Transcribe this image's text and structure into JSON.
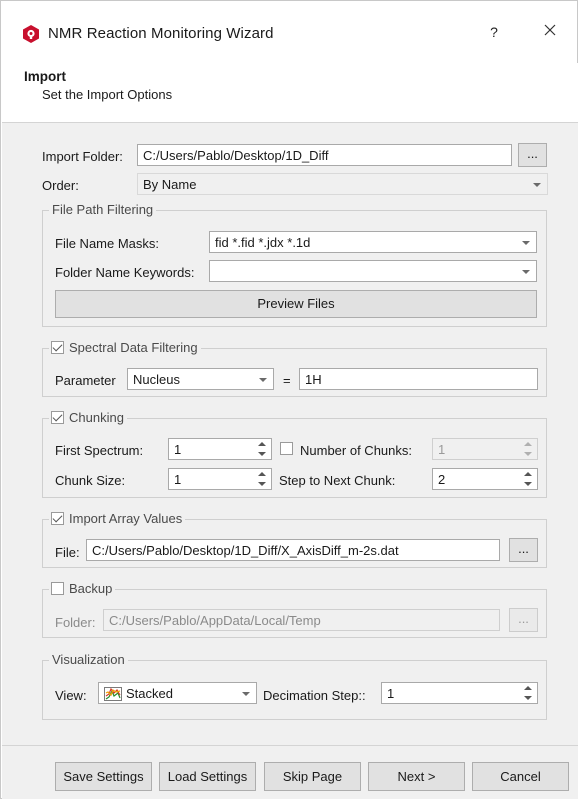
{
  "window": {
    "title": "NMR Reaction Monitoring Wizard",
    "help_label": "?",
    "close_label": "✕",
    "icon": "app-logo-icon"
  },
  "header": {
    "title": "Import",
    "subtitle": "Set the Import Options"
  },
  "import": {
    "folder_label": "Import Folder:",
    "folder_value": "C:/Users/Pablo/Desktop/1D_Diff",
    "browse_label": "...",
    "order_label": "Order:",
    "order_value": "By Name"
  },
  "file_path_filtering": {
    "legend": "File Path Filtering",
    "masks_label": "File Name Masks:",
    "masks_value": "fid *.fid *.jdx *.1d",
    "keywords_label": "Folder Name Keywords:",
    "keywords_value": "",
    "preview_label": "Preview Files"
  },
  "spectral_filtering": {
    "legend": "Spectral Data Filtering",
    "checked": true,
    "parameter_label": "Parameter",
    "parameter_value": "Nucleus",
    "equals": "=",
    "value": "1H"
  },
  "chunking": {
    "legend": "Chunking",
    "checked": true,
    "first_spectrum_label": "First Spectrum:",
    "first_spectrum_value": "1",
    "num_chunks_label": "Number of Chunks:",
    "num_chunks_checked": false,
    "num_chunks_value": "1",
    "chunk_size_label": "Chunk Size:",
    "chunk_size_value": "1",
    "step_label": "Step to Next Chunk:",
    "step_value": "2"
  },
  "array_values": {
    "legend": "Import Array Values",
    "checked": true,
    "file_label": "File:",
    "file_value": "C:/Users/Pablo/Desktop/1D_Diff/X_AxisDiff_m-2s.dat",
    "browse_label": "..."
  },
  "backup": {
    "legend": "Backup",
    "checked": false,
    "folder_label": "Folder:",
    "folder_value": "C:/Users/Pablo/AppData/Local/Temp",
    "browse_label": "..."
  },
  "visualization": {
    "legend": "Visualization",
    "view_label": "View:",
    "view_value": "Stacked",
    "view_icon": "stacked-chart-icon",
    "decimation_label": "Decimation Step::",
    "decimation_value": "1"
  },
  "footer": {
    "save_settings": "Save Settings",
    "load_settings": "Load Settings",
    "skip_page": "Skip Page",
    "next": "Next >",
    "cancel": "Cancel"
  },
  "colors": {
    "content_bg": "#f0f0f0",
    "logo_red": "#c8102e"
  }
}
